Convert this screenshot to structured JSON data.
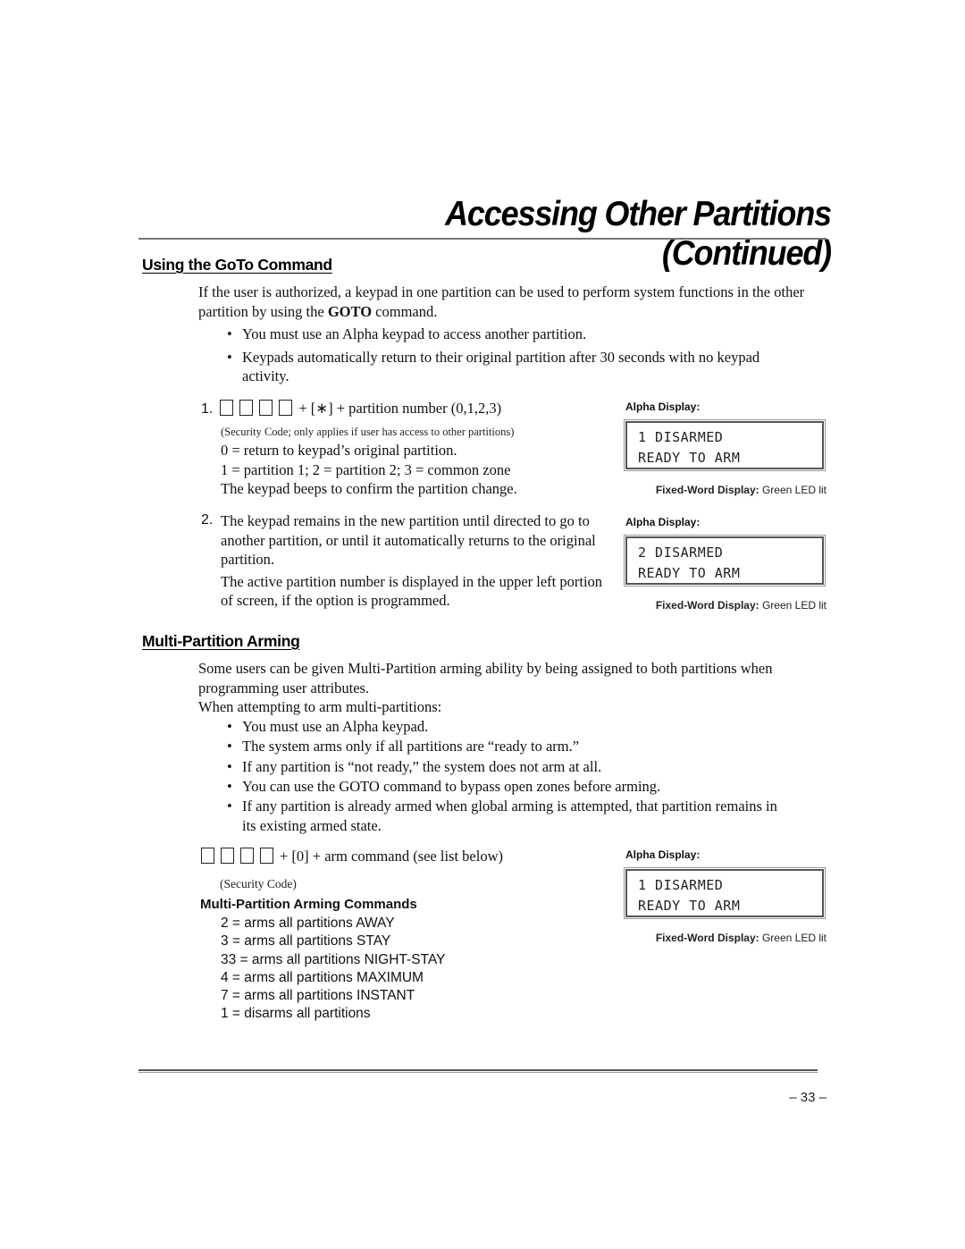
{
  "page": {
    "title": "Accessing Other Partitions (Continued)",
    "page_number": "– 33 –"
  },
  "goto_section": {
    "heading": "Using the GoTo Command",
    "intro_before_bold": "If the user is authorized, a keypad in one partition can be used to perform system functions in the other partition by using the ",
    "intro_bold": "GOTO",
    "intro_after_bold": " command.",
    "bullets": [
      "You must use an Alpha keypad to access another partition.",
      "Keypads automatically return to their original partition after 30 seconds with no keypad activity."
    ],
    "step1": {
      "number": "1.",
      "key_sequence": "+  [∗] + partition number (0,1,2,3)",
      "note": "(Security Code; only applies if user has access to other partitions)",
      "lines": [
        "0 = return to keypad’s original partition.",
        "1 = partition 1; 2 = partition 2; 3 = common zone",
        "The keypad beeps to confirm the partition change."
      ]
    },
    "step2": {
      "number": "2.",
      "text": "The keypad remains in the new partition until directed to go to another partition, or until it automatically returns to the original partition.",
      "text2": "The active partition number is displayed in the upper left portion of screen, if the option is programmed."
    }
  },
  "displays": [
    {
      "label": "Alpha Display:",
      "line1": "1 DISARMED",
      "line2": "READY TO ARM",
      "fixed_word_label": "Fixed-Word Display:",
      "fixed_word_value": " Green LED lit"
    },
    {
      "label": "Alpha Display:",
      "line1": "2 DISARMED",
      "line2": "READY TO ARM",
      "fixed_word_label": "Fixed-Word Display:",
      "fixed_word_value": " Green LED lit"
    },
    {
      "label": "Alpha Display:",
      "line1": "1 DISARMED",
      "line2": "READY TO ARM",
      "fixed_word_label": "Fixed-Word Display:",
      "fixed_word_value": " Green LED lit"
    }
  ],
  "multi_section": {
    "heading": "Multi-Partition Arming",
    "intro": "Some users can be given Multi-Partition arming ability by being assigned to both partitions when programming user attributes.",
    "intro2": "When attempting to arm multi-partitions:",
    "bullets": [
      "You must use an Alpha keypad.",
      "The system arms only if all partitions are “ready to arm.”",
      "If any partition is “not ready,” the system does not arm at all.",
      "You can use the GOTO command to bypass open zones before arming.",
      "If any partition is already armed when global arming is attempted, that partition remains in its existing armed state."
    ],
    "key_sequence": "+  [0] + arm command (see list below)",
    "key_note": "(Security Code)",
    "commands_heading": "Multi-Partition Arming Commands",
    "commands": [
      "2 = arms all partitions AWAY",
      "3 = arms all partitions STAY",
      "33 = arms all partitions NIGHT-STAY",
      "4 = arms all partitions MAXIMUM",
      "7 = arms all partitions INSTANT",
      "1 = disarms all partitions"
    ]
  },
  "icons": {
    "bullet": "•",
    "key_box": "empty-square"
  }
}
